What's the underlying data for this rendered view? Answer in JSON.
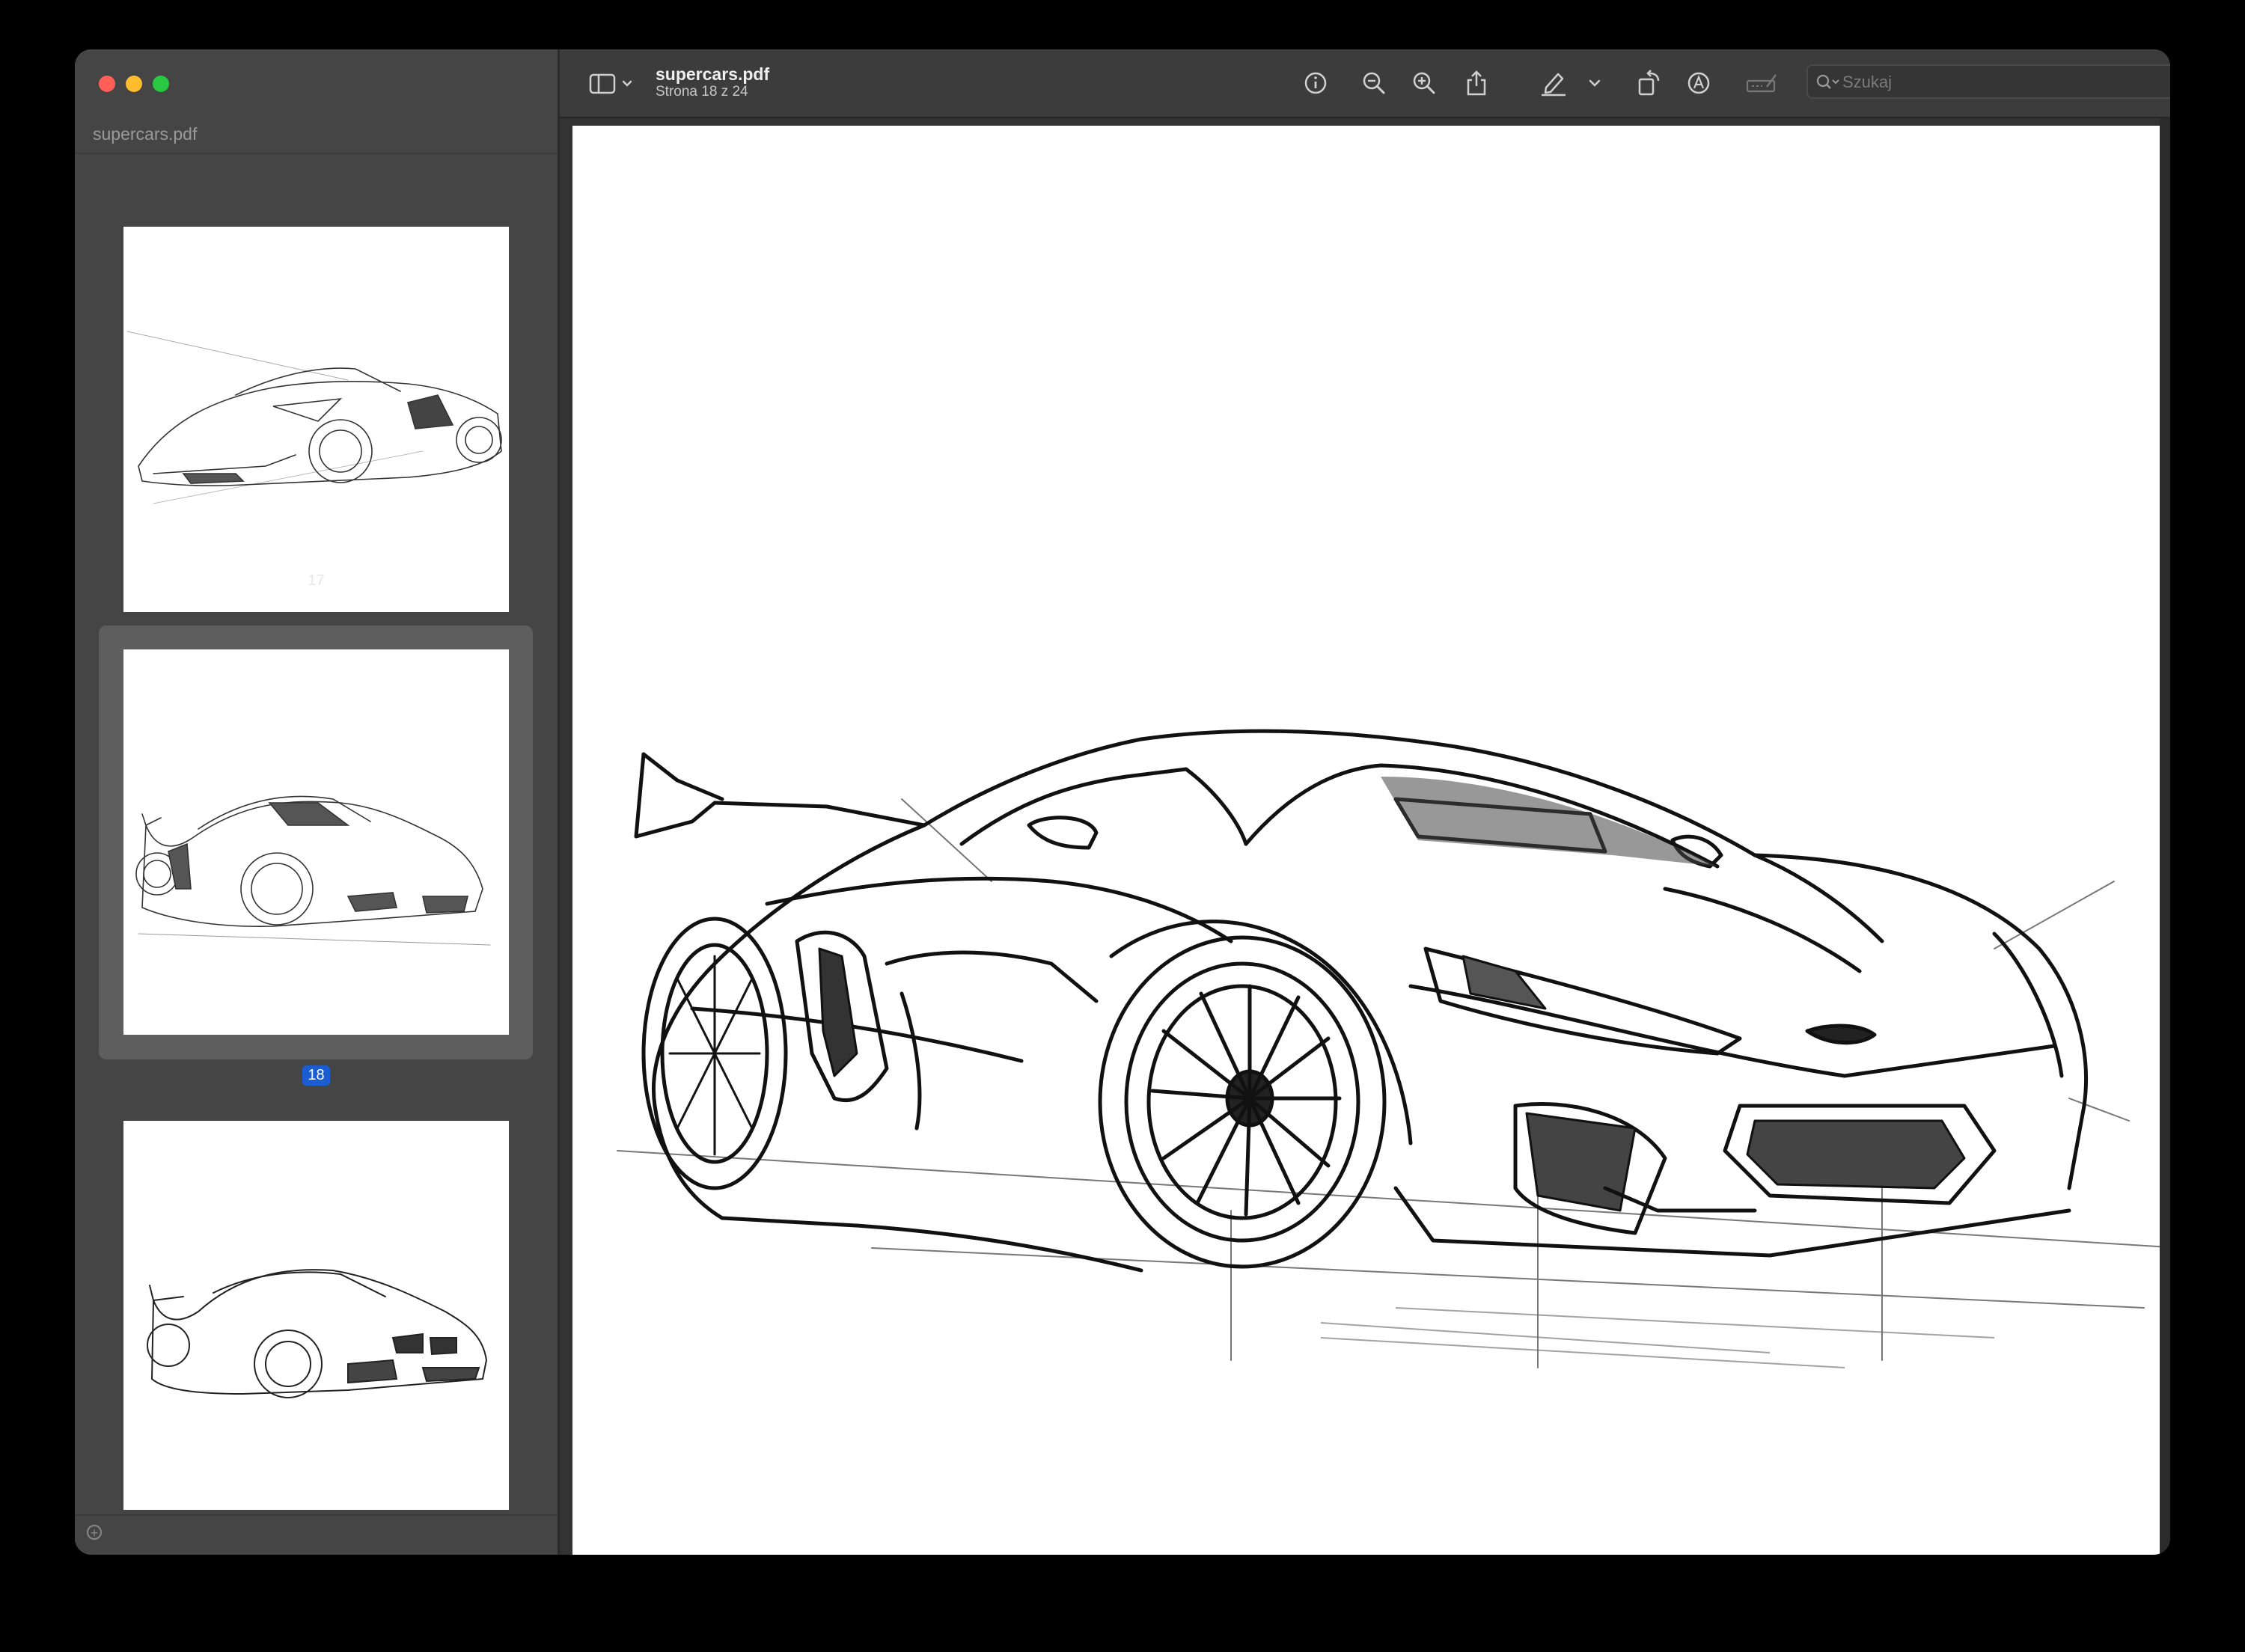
{
  "sidebar": {
    "title": "supercars.pdf",
    "thumbnails": [
      {
        "page": "17",
        "selected": false
      },
      {
        "page": "18",
        "selected": true
      },
      {
        "page": "",
        "selected": false
      }
    ]
  },
  "toolbar": {
    "doc_name": "supercars.pdf",
    "page_info": "Strona 18 z 24",
    "search_placeholder": "Szukaj",
    "icons": [
      "sidebar-toggle-icon",
      "chevron-down-icon",
      "info-icon",
      "zoom-out-icon",
      "zoom-in-icon",
      "share-icon",
      "highlight-pen-icon",
      "chevron-down-icon",
      "rotate-icon",
      "markup-icon",
      "form-fill-icon",
      "search-icon"
    ]
  },
  "colors": {
    "window_bg": "#3a3a3a",
    "sidebar_bg": "#454545",
    "selection_bg": "#5e5e5e",
    "page_badge": "#1b5dd1",
    "close": "#ff5f57",
    "minimize": "#febc2e",
    "maximize": "#28c840"
  }
}
